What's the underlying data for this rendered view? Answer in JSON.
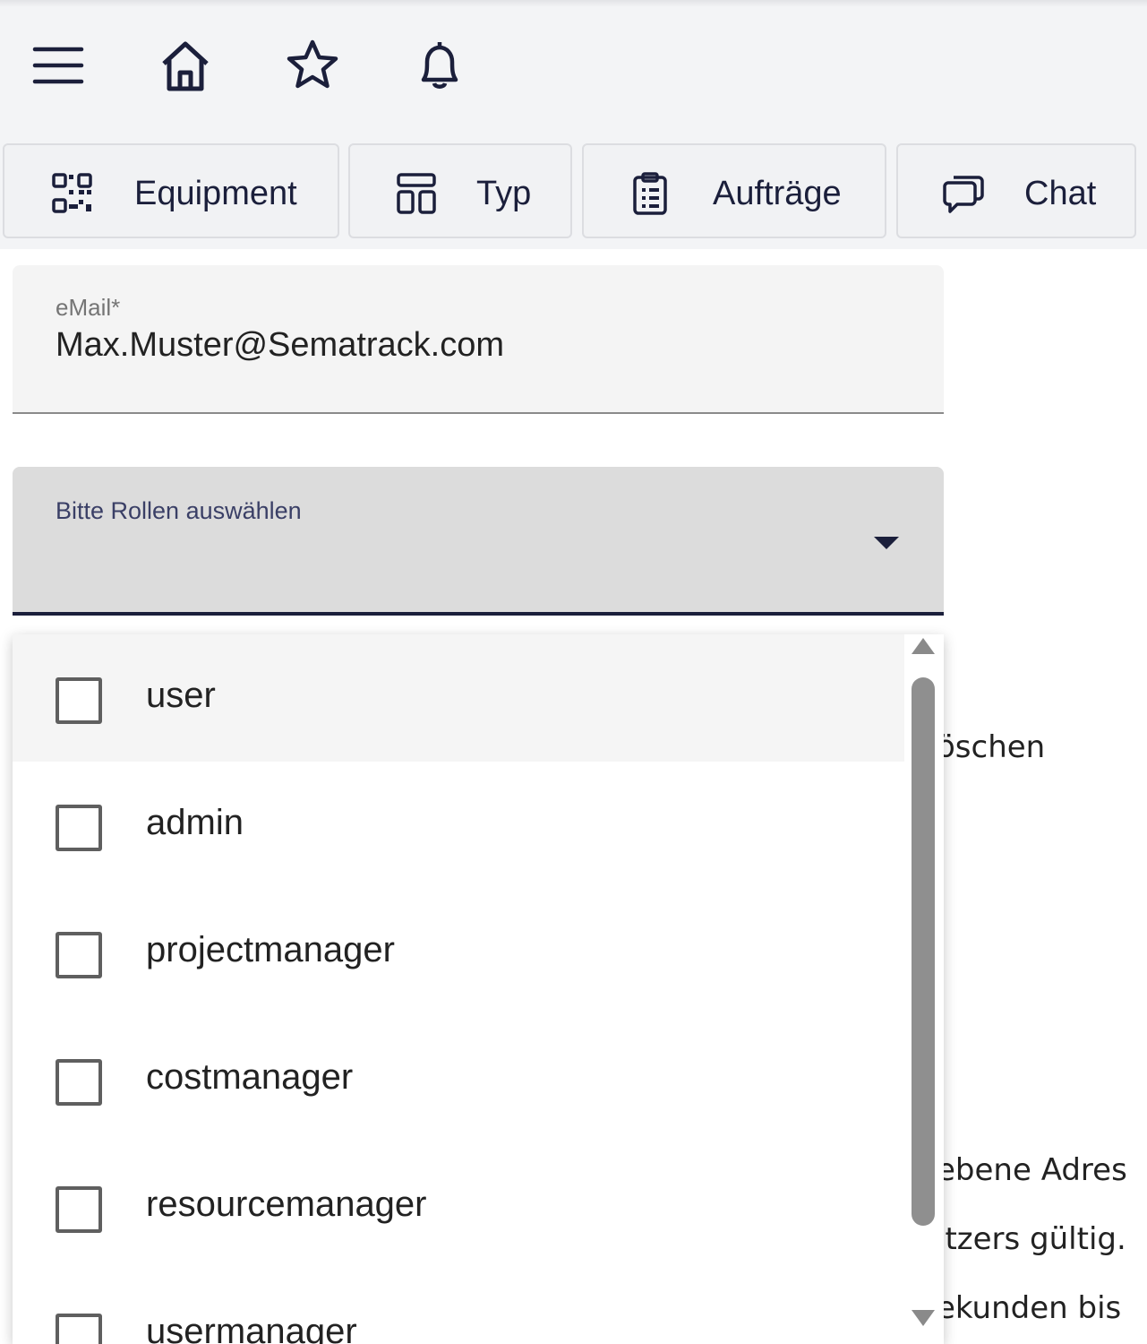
{
  "toolbar": {
    "menu_icon": "menu-icon",
    "home_icon": "home-icon",
    "favorites_icon": "star-icon",
    "notifications_icon": "bell-icon"
  },
  "nav": {
    "equipment": {
      "label": "Equipment",
      "icon": "qr-code-icon"
    },
    "typ": {
      "label": "Typ",
      "icon": "layout-icon"
    },
    "auftraege": {
      "label": "Aufträge",
      "icon": "clipboard-icon"
    },
    "chat": {
      "label": "Chat",
      "icon": "chat-icon"
    }
  },
  "form": {
    "email": {
      "label": "eMail*",
      "value": "Max.Muster@Sematrack.com"
    },
    "roles": {
      "label": "Bitte Rollen auswählen"
    }
  },
  "roles_options": [
    {
      "label": "user",
      "checked": false
    },
    {
      "label": "admin",
      "checked": false
    },
    {
      "label": "projectmanager",
      "checked": false
    },
    {
      "label": "costmanager",
      "checked": false
    },
    {
      "label": "resourcemanager",
      "checked": false
    },
    {
      "label": "usermanager",
      "checked": false
    }
  ],
  "background_text": {
    "line1": "öschen",
    "line2": "ebene Adres",
    "line3": "itzers gültig.",
    "line4": "ekunden bis"
  },
  "colors": {
    "primary": "#1b1f3b",
    "surface": "#f3f4f6",
    "select_active_bg": "#dcdcdc"
  }
}
